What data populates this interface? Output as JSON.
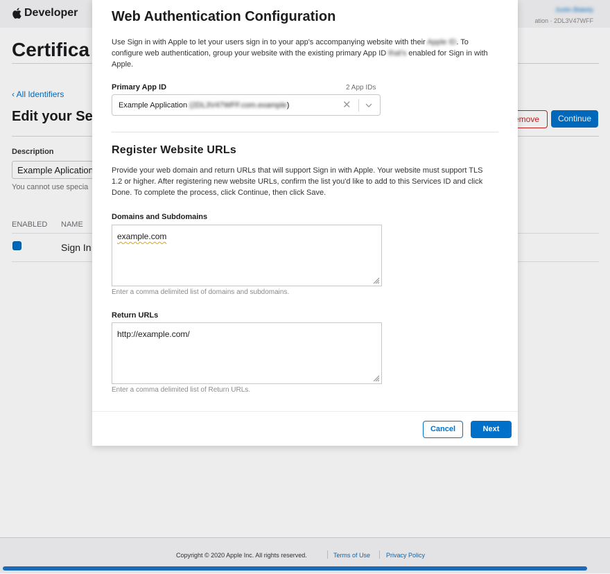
{
  "header": {
    "brand": "Developer",
    "account_name": "Justin Blakely",
    "team_line": "ation · 2DL3V47WFF"
  },
  "page": {
    "title": "Certifica",
    "back_link": "‹ All Identifiers",
    "subtitle": "Edit your Ser",
    "remove_label": "emove",
    "continue_label": "Continue",
    "description_label": "Description",
    "description_value": "Example Aplication",
    "description_help": "You cannot use specia",
    "col_enabled": "ENABLED",
    "col_name": "NAME",
    "capability_name": "Sign In",
    "capability_enabled": true
  },
  "modal": {
    "title": "Web Authentication Configuration",
    "intro_part1": "Use Sign in with Apple to let your users sign in to your app's accompanying website with their ",
    "intro_blur1": "Apple ID",
    "intro_part2": ". To configure web authentication, group your website with the existing primary App ID ",
    "intro_blur2": "that's",
    "intro_part3": " enabled for Sign in with Apple.",
    "primary_label": "Primary App ID",
    "primary_count": "2 App IDs",
    "primary_prefix": "Example Application",
    "primary_blur": " (2DL3V47WFF.com.example",
    "primary_suffix": ")",
    "section_title": "Register Website URLs",
    "section_text": "Provide your web domain and return URLs that will support Sign in with Apple. Your website must support TLS 1.2 or higher. After registering new website URLs, confirm the list you'd like to add to this Services ID and click Done. To complete the process, click Continue, then click Save.",
    "domains_label": "Domains and Subdomains",
    "domains_value": "example.com",
    "domains_help": "Enter a comma delimited list of domains and subdomains.",
    "return_label": "Return URLs",
    "return_value": "http://example.com/",
    "return_help": "Enter a comma delimited list of Return URLs.",
    "cancel_label": "Cancel",
    "next_label": "Next"
  },
  "footer": {
    "copyright": "Copyright © 2020 Apple Inc. All rights reserved.",
    "terms": "Terms of Use",
    "privacy": "Privacy Policy"
  },
  "colors": {
    "accent": "#0070c9",
    "danger": "#d11f1f"
  }
}
